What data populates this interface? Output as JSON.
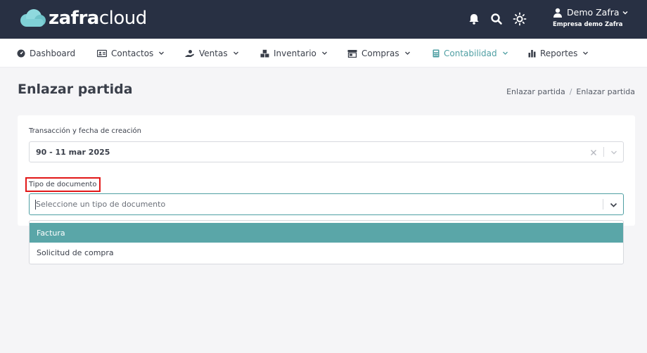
{
  "brand": {
    "bold": "zafra",
    "light": "cloud"
  },
  "topbar": {
    "icons": [
      "bell-icon",
      "search-icon",
      "sun-icon"
    ],
    "user_name": "Demo Zafra",
    "company": "Empresa demo Zafra"
  },
  "nav": {
    "items": [
      {
        "label": "Dashboard",
        "icon": "dashboard-icon",
        "has_caret": false
      },
      {
        "label": "Contactos",
        "icon": "address-card-icon",
        "has_caret": true
      },
      {
        "label": "Ventas",
        "icon": "hand-icon",
        "has_caret": true
      },
      {
        "label": "Inventario",
        "icon": "boxes-icon",
        "has_caret": true
      },
      {
        "label": "Compras",
        "icon": "store-icon",
        "has_caret": true
      },
      {
        "label": "Contabilidad",
        "icon": "calculator-icon",
        "has_caret": true,
        "active": true
      },
      {
        "label": "Reportes",
        "icon": "bar-chart-icon",
        "has_caret": true
      }
    ],
    "active_color": "#4f9fa3"
  },
  "page": {
    "title": "Enlazar partida",
    "breadcrumb": [
      "Enlazar partida",
      "Enlazar partida"
    ]
  },
  "form": {
    "transaction_label": "Transacción y fecha de creación",
    "transaction_value": "90 - 11 mar 2025",
    "doc_type_label": "Tipo de documento",
    "doc_type_placeholder": "Seleccione un tipo de documento",
    "doc_type_options": [
      "Factura",
      "Solicitud de compra"
    ],
    "highlighted_option": "Factura"
  },
  "colors": {
    "topbar": "#283043",
    "accent": "#5aa6a8",
    "highlight_border": "#e21818"
  }
}
